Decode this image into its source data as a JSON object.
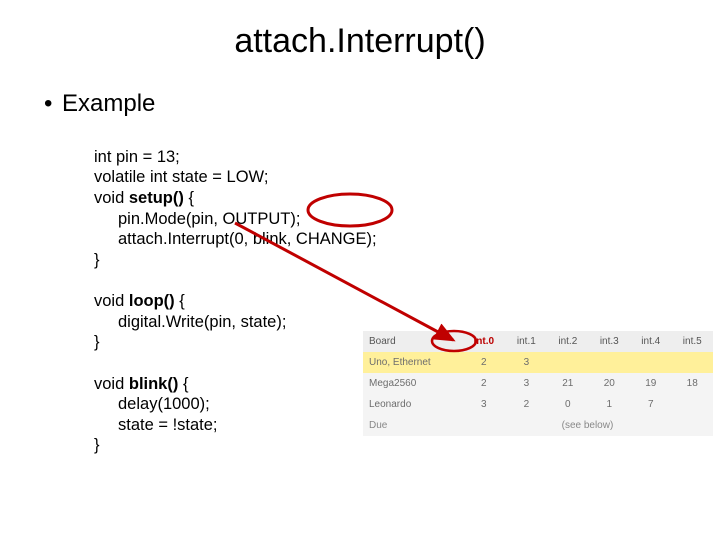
{
  "title": "attach.Interrupt()",
  "bullet": "Example",
  "code": {
    "l1": "int pin = 13;",
    "l2": "volatile int state = LOW;",
    "l3a": "void ",
    "l3b": "setup() ",
    "l3c": "{",
    "l4": "pin.Mode(pin, OUTPUT);",
    "l5": "attach.Interrupt(0, blink, CHANGE);",
    "l6": "}",
    "l8a": "void ",
    "l8b": "loop() ",
    "l8c": "{",
    "l9": "digital.Write(pin, state);",
    "l10": "}",
    "l12a": "void ",
    "l12b": "blink() ",
    "l12c": "{",
    "l13": "delay(1000);",
    "l14": "state = !state;",
    "l15": "}"
  },
  "table": {
    "headers": [
      "Board",
      "int.0",
      "int.1",
      "int.2",
      "int.3",
      "int.4",
      "int.5"
    ],
    "rows": [
      {
        "board": "Uno, Ethernet",
        "cells": [
          "2",
          "3",
          "",
          "",
          "",
          ""
        ],
        "hl": true
      },
      {
        "board": "Mega2560",
        "cells": [
          "2",
          "3",
          "21",
          "20",
          "19",
          "18"
        ],
        "hl": false
      },
      {
        "board": "Leonardo",
        "cells": [
          "3",
          "2",
          "0",
          "1",
          "7",
          ""
        ],
        "hl": false
      }
    ],
    "footer": {
      "board": "Due",
      "note": "(see below)"
    }
  },
  "chart_data": {
    "type": "table",
    "title": "Interrupt number to digital pin mapping",
    "columns": [
      "Board",
      "int.0",
      "int.1",
      "int.2",
      "int.3",
      "int.4",
      "int.5"
    ],
    "rows": [
      [
        "Uno, Ethernet",
        2,
        3,
        null,
        null,
        null,
        null
      ],
      [
        "Mega2560",
        2,
        3,
        21,
        20,
        19,
        18
      ],
      [
        "Leonardo",
        3,
        2,
        0,
        1,
        7,
        null
      ],
      [
        "Due",
        "(see below)",
        null,
        null,
        null,
        null,
        null
      ]
    ]
  }
}
